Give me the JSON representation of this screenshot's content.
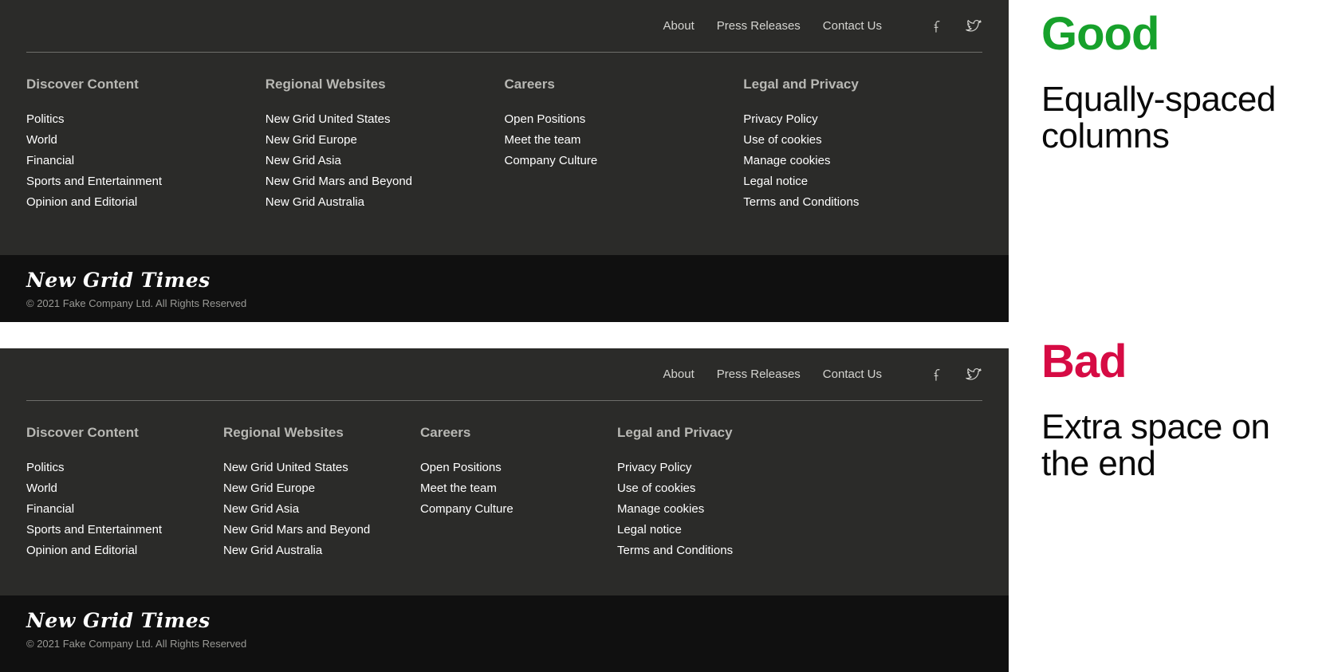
{
  "examples": [
    {
      "id": "good",
      "topnav": {
        "links": [
          {
            "label": "About"
          },
          {
            "label": "Press Releases"
          },
          {
            "label": "Contact Us"
          }
        ],
        "social": [
          {
            "icon": "facebook-icon",
            "label": "Facebook"
          },
          {
            "icon": "twitter-icon",
            "label": "Twitter"
          }
        ]
      },
      "columns": [
        {
          "title": "Discover Content",
          "links": [
            "Politics",
            "World",
            "Financial",
            "Sports and Entertainment",
            "Opinion and Editorial"
          ]
        },
        {
          "title": "Regional Websites",
          "links": [
            "New Grid United States",
            "New Grid Europe",
            "New Grid Asia",
            "New Grid Mars and Beyond",
            "New Grid Australia"
          ]
        },
        {
          "title": "Careers",
          "links": [
            "Open Positions",
            "Meet the team",
            "Company Culture"
          ]
        },
        {
          "title": "Legal and Privacy",
          "links": [
            "Privacy Policy",
            "Use of cookies",
            "Manage cookies",
            "Legal notice",
            "Terms and Conditions"
          ]
        }
      ],
      "bottom": {
        "brand": "New Grid Times",
        "copyright": "© 2021 Fake Company Ltd. All Rights Reserved"
      }
    },
    {
      "id": "bad",
      "topnav": {
        "links": [
          {
            "label": "About"
          },
          {
            "label": "Press Releases"
          },
          {
            "label": "Contact Us"
          }
        ],
        "social": [
          {
            "icon": "facebook-icon",
            "label": "Facebook"
          },
          {
            "icon": "twitter-icon",
            "label": "Twitter"
          }
        ]
      },
      "columns": [
        {
          "title": "Discover Content",
          "links": [
            "Politics",
            "World",
            "Financial",
            "Sports and Entertainment",
            "Opinion and Editorial"
          ]
        },
        {
          "title": "Regional Websites",
          "links": [
            "New Grid United States",
            "New Grid Europe",
            "New Grid Asia",
            "New Grid Mars and Beyond",
            "New Grid Australia"
          ]
        },
        {
          "title": "Careers",
          "links": [
            "Open Positions",
            "Meet the team",
            "Company Culture"
          ]
        },
        {
          "title": "Legal and Privacy",
          "links": [
            "Privacy Policy",
            "Use of cookies",
            "Manage cookies",
            "Legal notice",
            "Terms and Conditions"
          ]
        }
      ],
      "bottom": {
        "brand": "New Grid Times",
        "copyright": "© 2021 Fake Company Ltd. All Rights Reserved"
      }
    }
  ],
  "annotations": {
    "good": {
      "verdict": "Good",
      "description": "Equally-spaced columns",
      "color": "#17a12b"
    },
    "bad": {
      "verdict": "Bad",
      "description": "Extra space on the end",
      "color": "#d60b44"
    }
  },
  "colors": {
    "footer_background": "#2b2b29",
    "footer_bottom_background": "#101010",
    "page_background": "#ffffff",
    "link_text": "#ffffff",
    "heading_text": "#b8b8b4",
    "copyright_text": "#9a9a96"
  }
}
